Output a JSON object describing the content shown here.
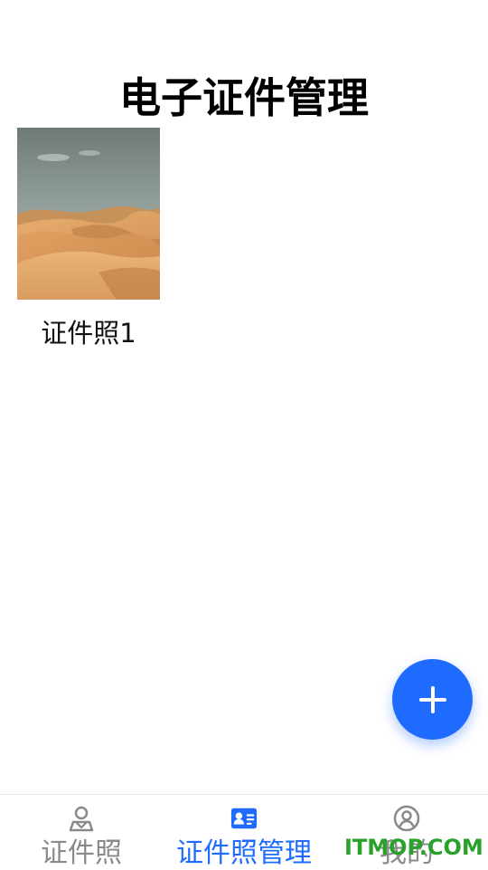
{
  "header": {
    "title": "电子证件管理"
  },
  "cards": [
    {
      "label": "证件照1",
      "image": "desert-dunes-photo"
    }
  ],
  "fab": {
    "icon": "plus-icon"
  },
  "tabbar": {
    "items": [
      {
        "label": "证件照",
        "icon": "person-pin-icon",
        "active": false
      },
      {
        "label": "证件照管理",
        "icon": "id-card-icon",
        "active": true
      },
      {
        "label": "我的",
        "icon": "user-circle-icon",
        "active": false
      }
    ]
  },
  "watermark": {
    "text": "ITMOP.COM"
  },
  "colors": {
    "accent": "#1f6bff",
    "inactive": "#8a8a8a",
    "watermark": "#2aa12a"
  }
}
